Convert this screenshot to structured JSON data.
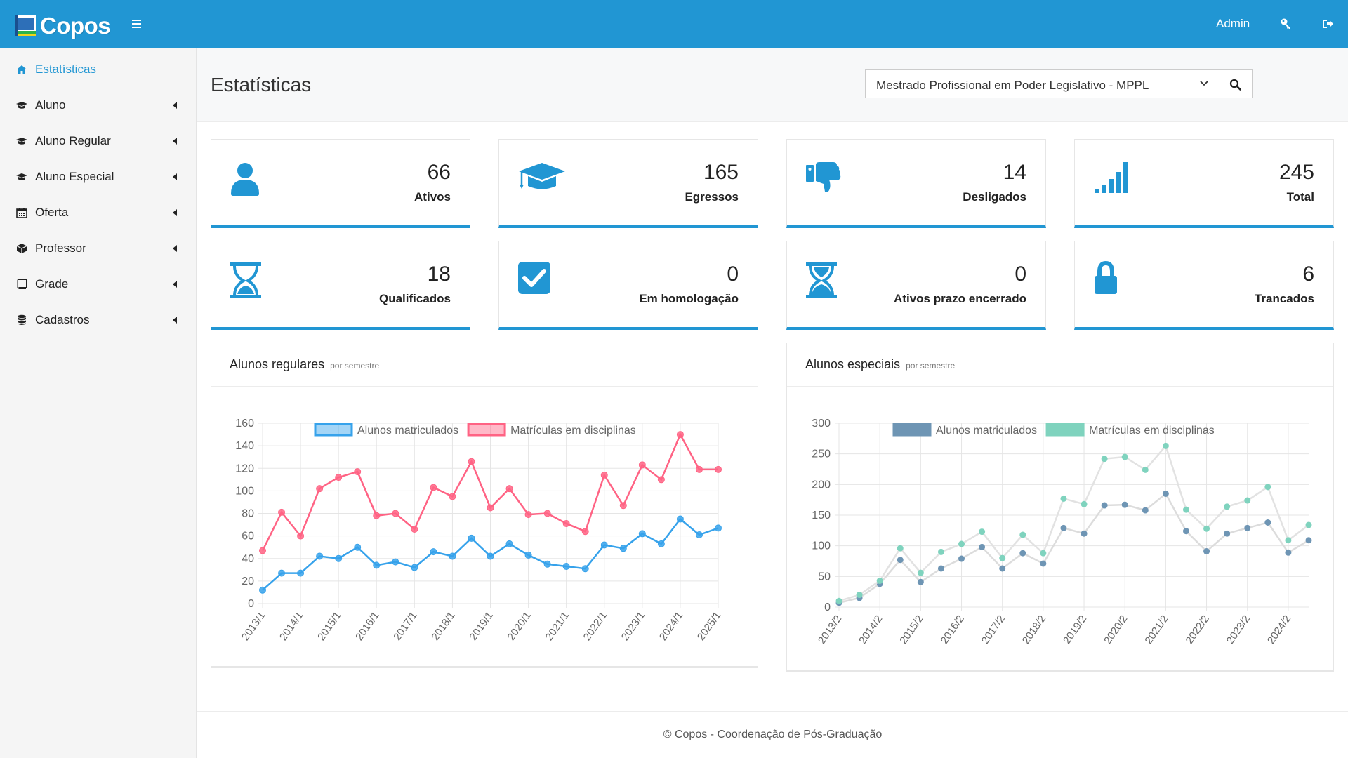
{
  "header": {
    "brand": "Copos",
    "user": "Admin"
  },
  "sidebar": {
    "items": [
      {
        "label": "Estatísticas",
        "icon": "home-icon"
      },
      {
        "label": "Aluno",
        "icon": "graduation-cap-icon"
      },
      {
        "label": "Aluno Regular",
        "icon": "graduation-cap-icon"
      },
      {
        "label": "Aluno Especial",
        "icon": "graduation-cap-icon"
      },
      {
        "label": "Oferta",
        "icon": "calendar-icon"
      },
      {
        "label": "Professor",
        "icon": "cube-icon"
      },
      {
        "label": "Grade",
        "icon": "book-icon"
      },
      {
        "label": "Cadastros",
        "icon": "database-icon"
      }
    ]
  },
  "page": {
    "title": "Estatísticas",
    "program_select": "Mestrado Profissional em Poder Legislativo - MPPL"
  },
  "stats": [
    {
      "value": "66",
      "label": "Ativos",
      "icon": "user-icon"
    },
    {
      "value": "165",
      "label": "Egressos",
      "icon": "graduation-cap-icon"
    },
    {
      "value": "14",
      "label": "Desligados",
      "icon": "thumbs-down-icon"
    },
    {
      "value": "245",
      "label": "Total",
      "icon": "signal-icon"
    },
    {
      "value": "18",
      "label": "Qualificados",
      "icon": "hourglass-icon"
    },
    {
      "value": "0",
      "label": "Em homologação",
      "icon": "check-square-icon"
    },
    {
      "value": "0",
      "label": "Ativos prazo encerrado",
      "icon": "hourglass-half-icon"
    },
    {
      "value": "6",
      "label": "Trancados",
      "icon": "lock-icon"
    }
  ],
  "panels": {
    "regulares": {
      "title": "Alunos regulares",
      "subtitle": "por semestre"
    },
    "especiais": {
      "title": "Alunos especiais",
      "subtitle": "por semestre"
    }
  },
  "footer": {
    "text": "© Copos - Coordenação de Pós-Graduação"
  },
  "colors": {
    "accent": "#2196d3",
    "reg_series1": "#36a2eb",
    "reg_series2": "#ff6384",
    "esp_series1": "#6e95b4",
    "esp_series2": "#7fd3be"
  },
  "chart_data": [
    {
      "type": "line",
      "legend": [
        "Alunos matriculados",
        "Matrículas em disciplinas"
      ],
      "tick_labels": [
        "2013/1",
        "2014/1",
        "2015/1",
        "2016/1",
        "2017/1",
        "2018/1",
        "2019/1",
        "2020/1",
        "2021/1",
        "2022/1",
        "2023/1",
        "2024/1",
        "2025/1"
      ],
      "x": [
        "2013/1",
        "2013/2",
        "2014/1",
        "2014/2",
        "2015/1",
        "2015/2",
        "2016/1",
        "2016/2",
        "2017/1",
        "2017/2",
        "2018/1",
        "2018/2",
        "2019/1",
        "2019/2",
        "2020/1",
        "2020/2",
        "2021/1",
        "2021/2",
        "2022/1",
        "2022/2",
        "2023/1",
        "2023/2",
        "2024/1",
        "2024/2",
        "2025/1"
      ],
      "series": [
        {
          "name": "Alunos matriculados",
          "values": [
            12,
            27,
            27,
            42,
            40,
            50,
            34,
            37,
            32,
            46,
            42,
            58,
            42,
            53,
            43,
            35,
            33,
            31,
            52,
            49,
            62,
            53,
            75,
            61,
            67
          ]
        },
        {
          "name": "Matrículas em disciplinas",
          "values": [
            47,
            81,
            60,
            102,
            112,
            117,
            78,
            80,
            66,
            103,
            95,
            126,
            85,
            102,
            79,
            80,
            71,
            64,
            114,
            87,
            123,
            110,
            150,
            119,
            119
          ]
        }
      ],
      "ylim": [
        0,
        160
      ],
      "yticks": [
        0,
        20,
        40,
        60,
        80,
        100,
        120,
        140,
        160
      ],
      "grid": true,
      "legend_position": "top"
    },
    {
      "type": "line",
      "legend": [
        "Alunos matriculados",
        "Matrículas em disciplinas"
      ],
      "tick_labels": [
        "2013/2",
        "2014/2",
        "2015/2",
        "2016/2",
        "2017/2",
        "2018/2",
        "2019/2",
        "2020/2",
        "2021/2",
        "2022/2",
        "2023/2",
        "2024/2"
      ],
      "x": [
        "2013/2",
        "2014/1",
        "2014/2",
        "2015/1",
        "2015/2",
        "2016/1",
        "2016/2",
        "2017/1",
        "2017/2",
        "2018/1",
        "2018/2",
        "2019/1",
        "2019/2",
        "2020/1",
        "2020/2",
        "2021/1",
        "2021/2",
        "2022/1",
        "2022/2",
        "2023/1",
        "2023/2",
        "2024/1",
        "2024/2",
        "2025/1"
      ],
      "series": [
        {
          "name": "Alunos matriculados",
          "values": [
            7,
            15,
            38,
            77,
            41,
            63,
            79,
            98,
            63,
            88,
            71,
            129,
            120,
            166,
            167,
            158,
            185,
            124,
            91,
            120,
            129,
            138,
            89,
            109
          ]
        },
        {
          "name": "Matrículas em disciplinas",
          "values": [
            10,
            20,
            43,
            96,
            56,
            90,
            103,
            123,
            80,
            118,
            88,
            177,
            168,
            242,
            245,
            224,
            263,
            159,
            128,
            164,
            174,
            196,
            109,
            134
          ]
        }
      ],
      "ylim": [
        0,
        300
      ],
      "yticks": [
        0,
        50,
        100,
        150,
        200,
        250,
        300
      ],
      "grid": true,
      "legend_position": "top"
    }
  ]
}
